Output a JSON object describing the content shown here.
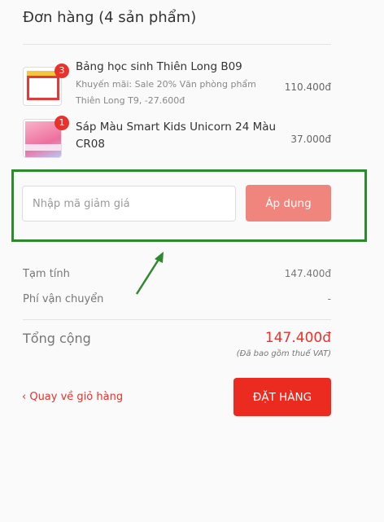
{
  "header": {
    "title": "Đơn hàng (4 sản phẩm)"
  },
  "products": [
    {
      "quantity": "3",
      "name": "Bảng học sinh Thiên Long B09",
      "promo": "Khuyến mãi: Sale 20% Văn phòng phẩm Thiên Long T9, -27.600đ",
      "price": "110.400đ"
    },
    {
      "quantity": "1",
      "name": "Sáp Màu Smart Kids Unicorn 24 Màu CR08",
      "promo": "",
      "price": "37.000đ"
    }
  ],
  "coupon": {
    "placeholder": "Nhập mã giảm giá",
    "value": "",
    "apply_label": "Áp dụng"
  },
  "summary": {
    "subtotal_label": "Tạm tính",
    "subtotal_value": "147.400đ",
    "shipping_label": "Phí vận chuyển",
    "shipping_value": "-",
    "total_label": "Tổng cộng",
    "total_value": "147.400đ",
    "vat_note": "(Đã bao gồm thuế VAT)"
  },
  "actions": {
    "back_label": "‹ Quay về giỏ hàng",
    "order_label": "ĐẶT HÀNG"
  },
  "colors": {
    "accent": "#ec2b20",
    "apply_button": "#f0857e",
    "highlight_box": "#2c8a2c"
  }
}
